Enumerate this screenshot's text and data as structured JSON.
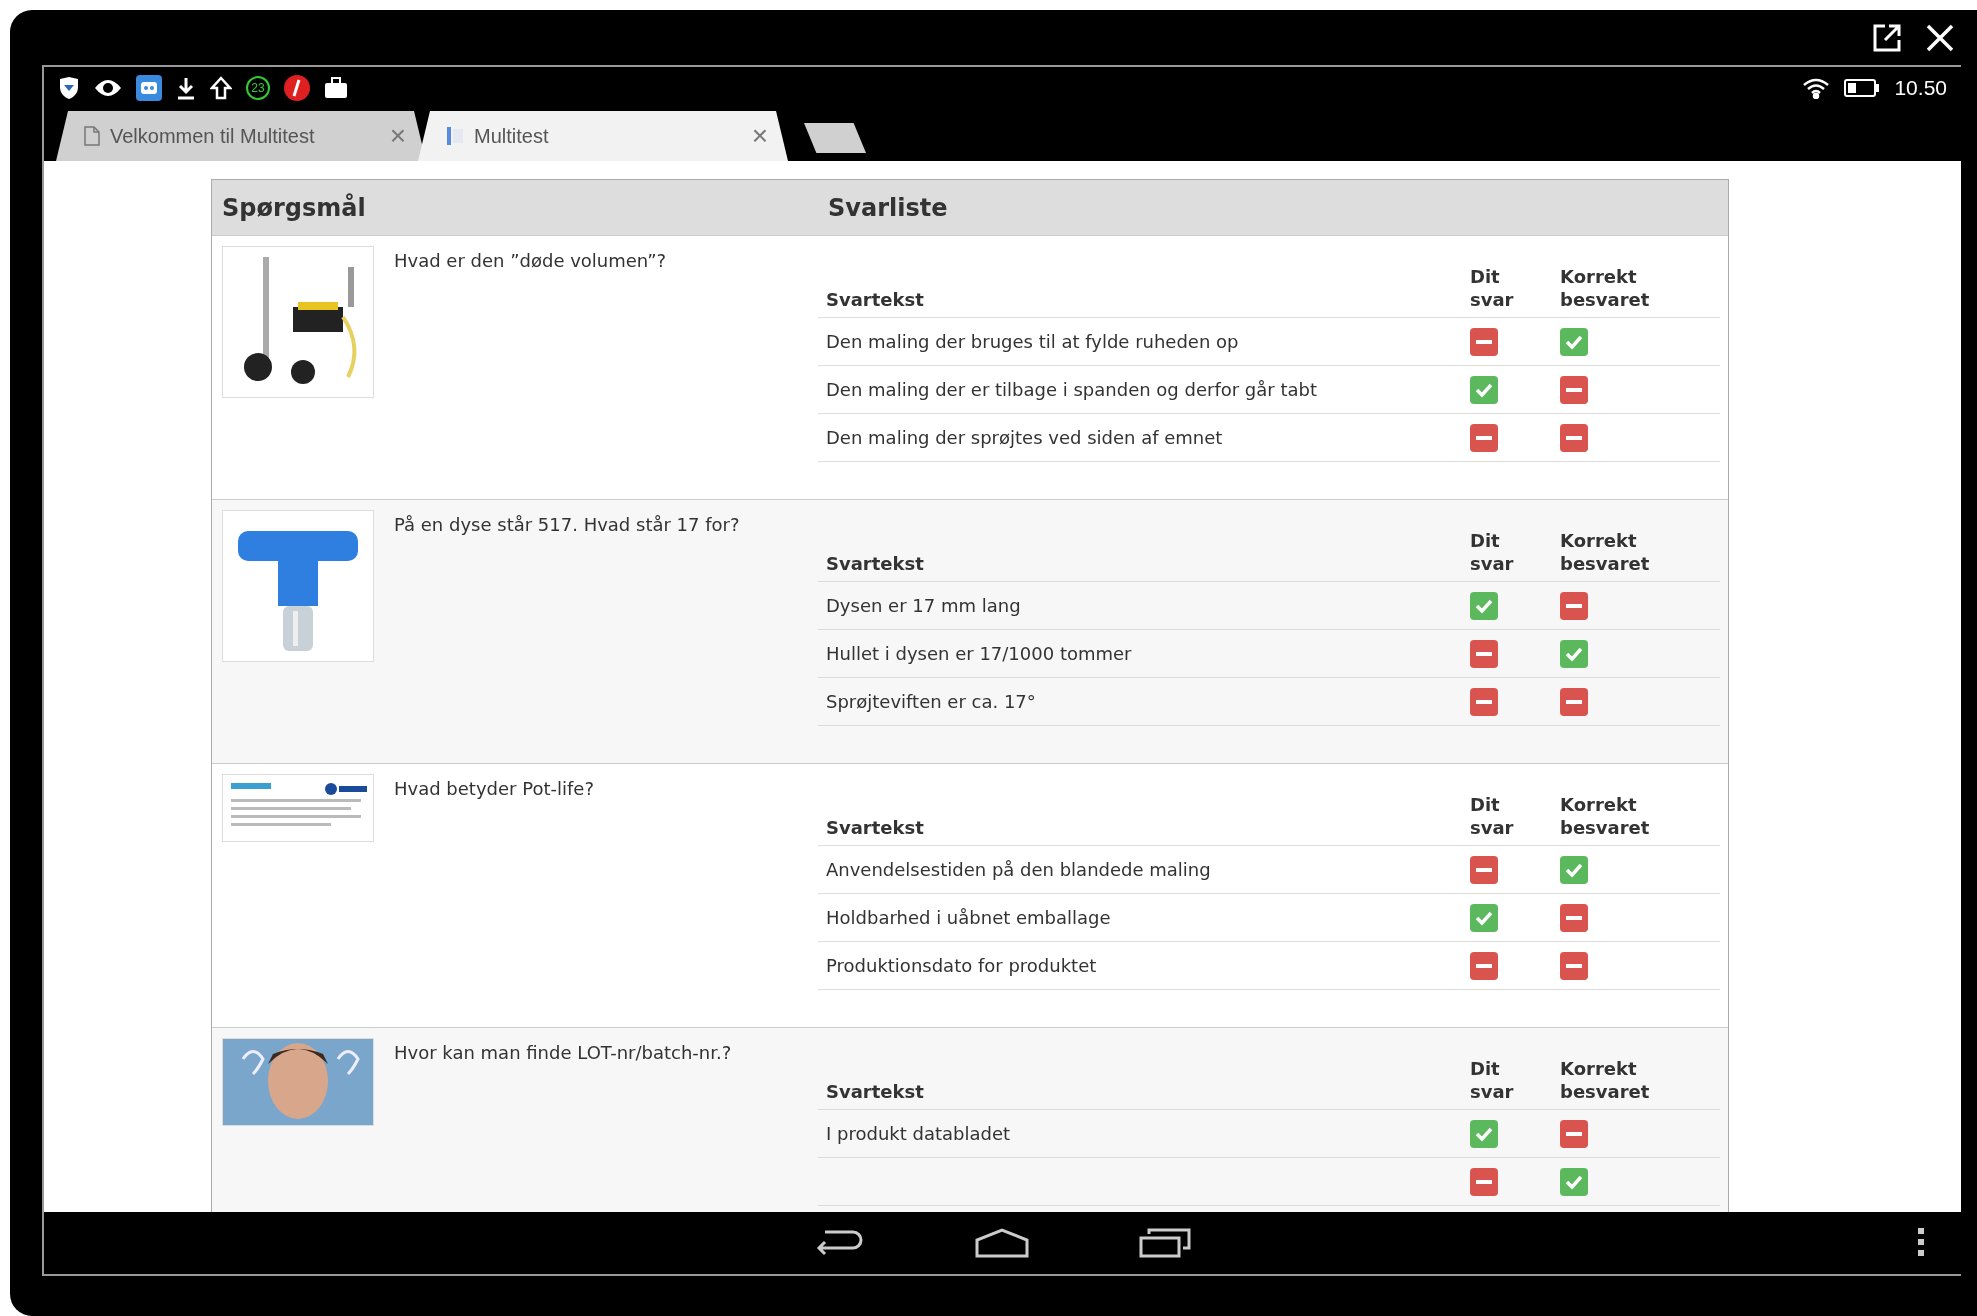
{
  "device": {
    "notification_count": "23",
    "time": "10.50"
  },
  "tabs": [
    {
      "label": "Velkommen til Multitest",
      "selected": false,
      "close": "×"
    },
    {
      "label": "Multitest",
      "selected": true,
      "close": "×"
    }
  ],
  "table": {
    "columns": [
      "Spørgsmål",
      "Svarliste"
    ],
    "questions": [
      {
        "question": "Hvad er den ”døde volumen”?",
        "headers": [
          "Svartekst",
          "Dit svar",
          "Korrekt besvaret"
        ],
        "answers": [
          {
            "text": "Den maling der bruges til at fylde ruheden op",
            "your_answer": false,
            "correct": true
          },
          {
            "text": "Den maling der er tilbage i spanden og derfor går tabt",
            "your_answer": true,
            "correct": false
          },
          {
            "text": "Den maling der sprøjtes ved siden af emnet",
            "your_answer": false,
            "correct": false
          }
        ]
      },
      {
        "question": "På en dyse står 517. Hvad står 17 for?",
        "headers": [
          "Svartekst",
          "Dit svar",
          "Korrekt besvaret"
        ],
        "answers": [
          {
            "text": "Dysen er 17 mm lang",
            "your_answer": true,
            "correct": false
          },
          {
            "text": "Hullet i dysen er 17/1000 tommer",
            "your_answer": false,
            "correct": true
          },
          {
            "text": "Sprøjteviften er ca. 17°",
            "your_answer": false,
            "correct": false
          }
        ]
      },
      {
        "question": "Hvad betyder Pot-life?",
        "headers": [
          "Svartekst",
          "Dit svar",
          "Korrekt besvaret"
        ],
        "answers": [
          {
            "text": "Anvendelsestiden på den blandede maling",
            "your_answer": false,
            "correct": true
          },
          {
            "text": "Holdbarhed i uåbnet emballage",
            "your_answer": true,
            "correct": false
          },
          {
            "text": "Produktionsdato for produktet",
            "your_answer": false,
            "correct": false
          }
        ]
      },
      {
        "question": "Hvor kan man finde LOT-nr/batch-nr.?",
        "headers": [
          "Svartekst",
          "Dit svar",
          "Korrekt besvaret"
        ],
        "answers": [
          {
            "text": "I produkt databladet",
            "your_answer": true,
            "correct": false
          },
          {
            "your_answer": false,
            "correct": true
          }
        ]
      }
    ]
  }
}
